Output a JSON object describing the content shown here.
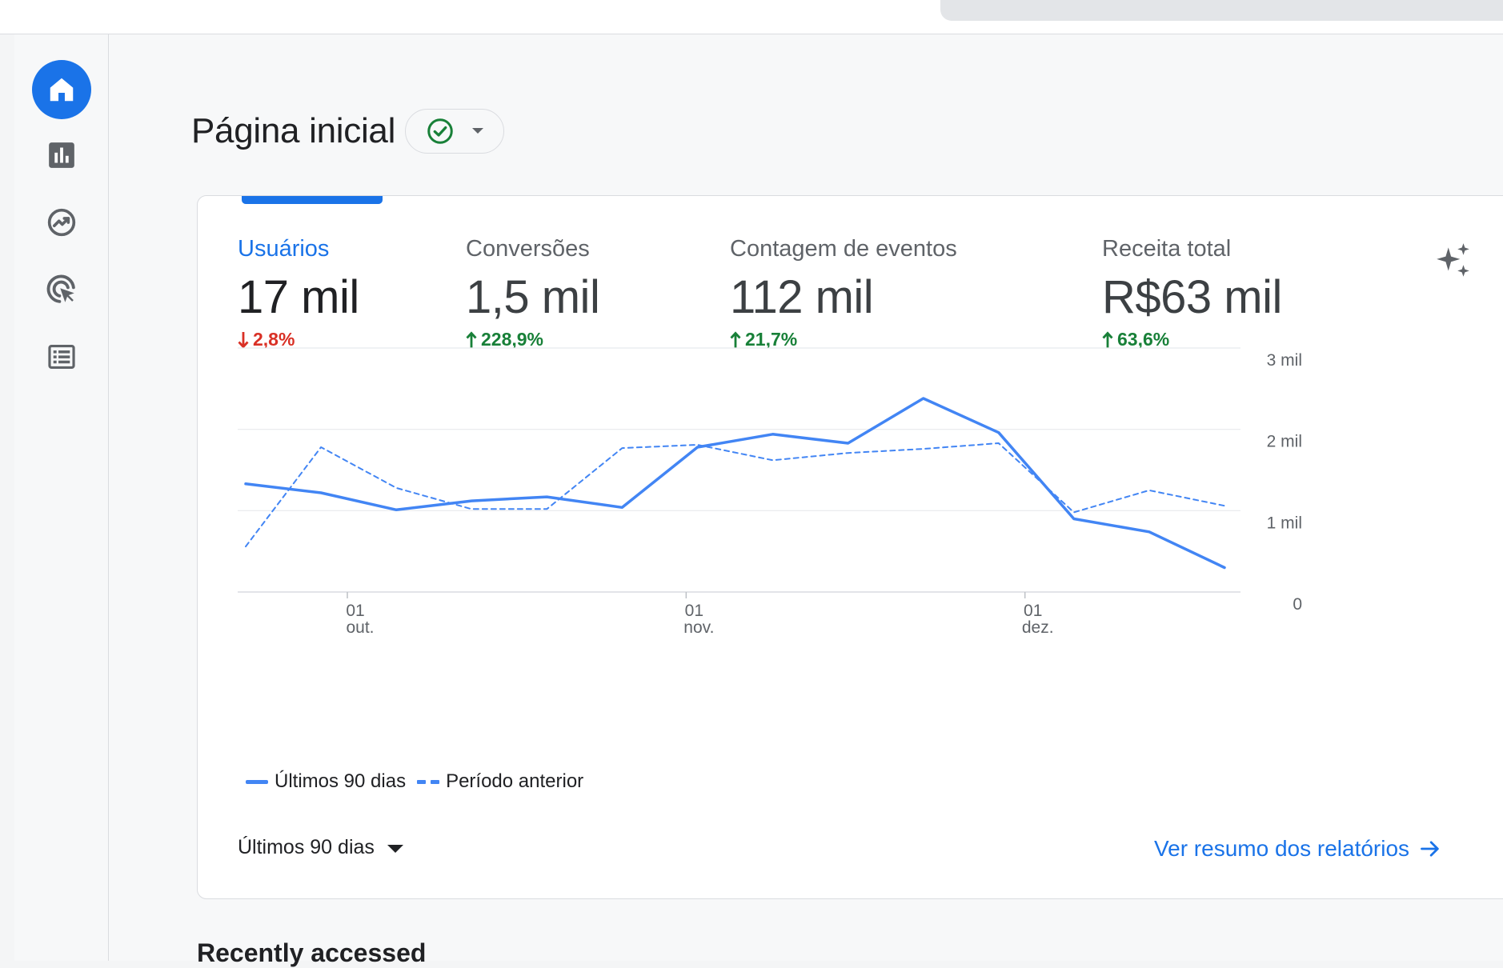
{
  "header": {
    "page_title": "Página inicial"
  },
  "rail": {
    "items": [
      {
        "icon": "home-icon",
        "active": true
      },
      {
        "icon": "reports-icon",
        "active": false
      },
      {
        "icon": "explore-icon",
        "active": false
      },
      {
        "icon": "advertising-icon",
        "active": false
      },
      {
        "icon": "configure-icon",
        "active": false
      }
    ]
  },
  "card": {
    "metrics": [
      {
        "label": "Usuários",
        "value": "17 mil",
        "change": "2,8%",
        "direction": "down",
        "selected": true
      },
      {
        "label": "Conversões",
        "value": "1,5 mil",
        "change": "228,9%",
        "direction": "up",
        "selected": false
      },
      {
        "label": "Contagem de eventos",
        "value": "112 mil",
        "change": "21,7%",
        "direction": "up",
        "selected": false
      },
      {
        "label": "Receita total",
        "value": "R$63 mil",
        "change": "63,6%",
        "direction": "up",
        "selected": false
      }
    ],
    "date_range_label": "Últimos 90 dias",
    "view_reports_link": "Ver resumo dos relatórios"
  },
  "recently_accessed": {
    "title": "Recently accessed"
  },
  "colors": {
    "accent": "#1a73e8",
    "series": "#4285f4",
    "negative": "#d93025",
    "positive": "#188038"
  },
  "chart_data": {
    "type": "line",
    "y_ticks": [
      "0",
      "1 mil",
      "2 mil",
      "3 mil"
    ],
    "ylim": [
      0,
      3000
    ],
    "x_ticks": [
      {
        "day": "01",
        "month": "out."
      },
      {
        "day": "01",
        "month": "nov."
      },
      {
        "day": "01",
        "month": "dez."
      }
    ],
    "grid": true,
    "legend_position": "bottom-left",
    "series": [
      {
        "name": "Últimos 90 dias",
        "style": "solid",
        "values": [
          1330,
          1220,
          1010,
          1120,
          1170,
          1040,
          1780,
          1940,
          1830,
          2380,
          1960,
          900,
          740,
          300
        ]
      },
      {
        "name": "Período anterior",
        "style": "dashed",
        "values": [
          560,
          1780,
          1280,
          1020,
          1020,
          1770,
          1810,
          1620,
          1710,
          1760,
          1830,
          980,
          1250,
          1060
        ]
      }
    ]
  }
}
